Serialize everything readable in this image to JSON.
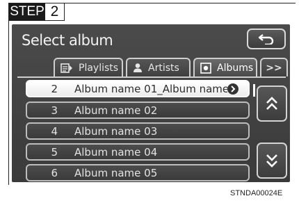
{
  "step": {
    "word": "STEP",
    "number": "2"
  },
  "screen": {
    "title": "Select album",
    "back_label": "back",
    "tabs": [
      {
        "label": "Playlists",
        "icon": "playlist-icon",
        "active": false
      },
      {
        "label": "Artists",
        "icon": "artist-icon",
        "active": false
      },
      {
        "label": "Albums",
        "icon": "album-icon",
        "active": true
      },
      {
        "label": ">>",
        "icon": "next-tabs",
        "active": false
      }
    ],
    "albums": [
      {
        "index": "2",
        "name": "Album name 01_Album name...",
        "selected": true
      },
      {
        "index": "3",
        "name": "Album name 02",
        "selected": false
      },
      {
        "index": "4",
        "name": "Album name 03",
        "selected": false
      },
      {
        "index": "5",
        "name": "Album name 04",
        "selected": false
      },
      {
        "index": "6",
        "name": "Album name 05",
        "selected": false
      }
    ],
    "scroll_up_icon": "double-chevron-up-icon",
    "scroll_down_icon": "double-chevron-down-icon"
  },
  "caption": "STNDA00024E",
  "colors": {
    "screen_bg": "#404040",
    "selected_row": "#ffffff",
    "frame": "#222222"
  }
}
